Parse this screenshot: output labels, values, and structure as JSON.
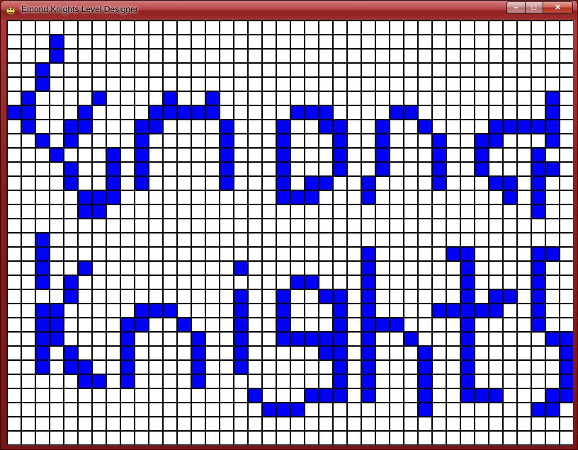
{
  "window": {
    "title": "Emond Knights Level Designer",
    "min_label": "–",
    "max_label": "□",
    "close_label": "✕"
  },
  "grid": {
    "columns": 40,
    "rows": 30,
    "empty_color": "#ffffff",
    "filled_color": "#0000ff",
    "line_color": "#000000",
    "filled_cells": [
      [
        3,
        1
      ],
      [
        3,
        2
      ],
      [
        2,
        3
      ],
      [
        2,
        4
      ],
      [
        1,
        5
      ],
      [
        6,
        5
      ],
      [
        11,
        5
      ],
      [
        14,
        5
      ],
      [
        38,
        5
      ],
      [
        0,
        6
      ],
      [
        1,
        6
      ],
      [
        5,
        6
      ],
      [
        10,
        6
      ],
      [
        11,
        6
      ],
      [
        12,
        6
      ],
      [
        13,
        6
      ],
      [
        14,
        6
      ],
      [
        20,
        6
      ],
      [
        21,
        6
      ],
      [
        22,
        6
      ],
      [
        27,
        6
      ],
      [
        28,
        6
      ],
      [
        38,
        6
      ],
      [
        1,
        7
      ],
      [
        4,
        7
      ],
      [
        5,
        7
      ],
      [
        9,
        7
      ],
      [
        10,
        7
      ],
      [
        15,
        7
      ],
      [
        19,
        7
      ],
      [
        22,
        7
      ],
      [
        23,
        7
      ],
      [
        26,
        7
      ],
      [
        29,
        7
      ],
      [
        34,
        7
      ],
      [
        35,
        7
      ],
      [
        36,
        7
      ],
      [
        37,
        7
      ],
      [
        38,
        7
      ],
      [
        2,
        8
      ],
      [
        4,
        8
      ],
      [
        9,
        8
      ],
      [
        15,
        8
      ],
      [
        19,
        8
      ],
      [
        23,
        8
      ],
      [
        26,
        8
      ],
      [
        30,
        8
      ],
      [
        33,
        8
      ],
      [
        34,
        8
      ],
      [
        38,
        8
      ],
      [
        3,
        9
      ],
      [
        7,
        9
      ],
      [
        9,
        9
      ],
      [
        15,
        9
      ],
      [
        19,
        9
      ],
      [
        23,
        9
      ],
      [
        26,
        9
      ],
      [
        30,
        9
      ],
      [
        33,
        9
      ],
      [
        37,
        9
      ],
      [
        4,
        10
      ],
      [
        7,
        10
      ],
      [
        9,
        10
      ],
      [
        15,
        10
      ],
      [
        19,
        10
      ],
      [
        23,
        10
      ],
      [
        26,
        10
      ],
      [
        30,
        10
      ],
      [
        33,
        10
      ],
      [
        37,
        10
      ],
      [
        38,
        10
      ],
      [
        4,
        11
      ],
      [
        7,
        11
      ],
      [
        9,
        11
      ],
      [
        15,
        11
      ],
      [
        19,
        11
      ],
      [
        21,
        11
      ],
      [
        22,
        11
      ],
      [
        25,
        11
      ],
      [
        30,
        11
      ],
      [
        34,
        11
      ],
      [
        35,
        11
      ],
      [
        37,
        11
      ],
      [
        5,
        12
      ],
      [
        6,
        12
      ],
      [
        7,
        12
      ],
      [
        19,
        12
      ],
      [
        20,
        12
      ],
      [
        21,
        12
      ],
      [
        25,
        12
      ],
      [
        35,
        12
      ],
      [
        37,
        12
      ],
      [
        5,
        13
      ],
      [
        6,
        13
      ],
      [
        37,
        13
      ],
      [
        2,
        15
      ],
      [
        2,
        16
      ],
      [
        25,
        16
      ],
      [
        31,
        16
      ],
      [
        32,
        16
      ],
      [
        37,
        16
      ],
      [
        38,
        16
      ],
      [
        2,
        17
      ],
      [
        5,
        17
      ],
      [
        16,
        17
      ],
      [
        25,
        17
      ],
      [
        32,
        17
      ],
      [
        37,
        17
      ],
      [
        2,
        18
      ],
      [
        4,
        18
      ],
      [
        20,
        18
      ],
      [
        21,
        18
      ],
      [
        25,
        18
      ],
      [
        32,
        18
      ],
      [
        37,
        18
      ],
      [
        4,
        19
      ],
      [
        16,
        19
      ],
      [
        19,
        19
      ],
      [
        22,
        19
      ],
      [
        23,
        19
      ],
      [
        25,
        19
      ],
      [
        32,
        19
      ],
      [
        34,
        19
      ],
      [
        35,
        19
      ],
      [
        37,
        19
      ],
      [
        2,
        20
      ],
      [
        3,
        20
      ],
      [
        9,
        20
      ],
      [
        10,
        20
      ],
      [
        11,
        20
      ],
      [
        16,
        20
      ],
      [
        19,
        20
      ],
      [
        23,
        20
      ],
      [
        25,
        20
      ],
      [
        30,
        20
      ],
      [
        31,
        20
      ],
      [
        32,
        20
      ],
      [
        33,
        20
      ],
      [
        34,
        20
      ],
      [
        37,
        20
      ],
      [
        2,
        21
      ],
      [
        3,
        21
      ],
      [
        8,
        21
      ],
      [
        9,
        21
      ],
      [
        12,
        21
      ],
      [
        16,
        21
      ],
      [
        19,
        21
      ],
      [
        23,
        21
      ],
      [
        25,
        21
      ],
      [
        26,
        21
      ],
      [
        27,
        21
      ],
      [
        32,
        21
      ],
      [
        37,
        21
      ],
      [
        2,
        22
      ],
      [
        3,
        22
      ],
      [
        8,
        22
      ],
      [
        13,
        22
      ],
      [
        16,
        22
      ],
      [
        19,
        22
      ],
      [
        20,
        22
      ],
      [
        21,
        22
      ],
      [
        22,
        22
      ],
      [
        23,
        22
      ],
      [
        25,
        22
      ],
      [
        28,
        22
      ],
      [
        32,
        22
      ],
      [
        38,
        22
      ],
      [
        39,
        22
      ],
      [
        2,
        23
      ],
      [
        4,
        23
      ],
      [
        8,
        23
      ],
      [
        13,
        23
      ],
      [
        16,
        23
      ],
      [
        22,
        23
      ],
      [
        23,
        23
      ],
      [
        25,
        23
      ],
      [
        29,
        23
      ],
      [
        32,
        23
      ],
      [
        39,
        23
      ],
      [
        2,
        24
      ],
      [
        4,
        24
      ],
      [
        5,
        24
      ],
      [
        8,
        24
      ],
      [
        13,
        24
      ],
      [
        16,
        24
      ],
      [
        23,
        24
      ],
      [
        25,
        24
      ],
      [
        29,
        24
      ],
      [
        32,
        24
      ],
      [
        39,
        24
      ],
      [
        5,
        25
      ],
      [
        6,
        25
      ],
      [
        8,
        25
      ],
      [
        13,
        25
      ],
      [
        23,
        25
      ],
      [
        25,
        25
      ],
      [
        29,
        25
      ],
      [
        32,
        25
      ],
      [
        39,
        25
      ],
      [
        17,
        26
      ],
      [
        21,
        26
      ],
      [
        22,
        26
      ],
      [
        23,
        26
      ],
      [
        25,
        26
      ],
      [
        29,
        26
      ],
      [
        32,
        26
      ],
      [
        33,
        26
      ],
      [
        34,
        26
      ],
      [
        38,
        26
      ],
      [
        39,
        26
      ],
      [
        18,
        27
      ],
      [
        19,
        27
      ],
      [
        20,
        27
      ],
      [
        29,
        27
      ],
      [
        37,
        27
      ],
      [
        38,
        27
      ]
    ]
  }
}
